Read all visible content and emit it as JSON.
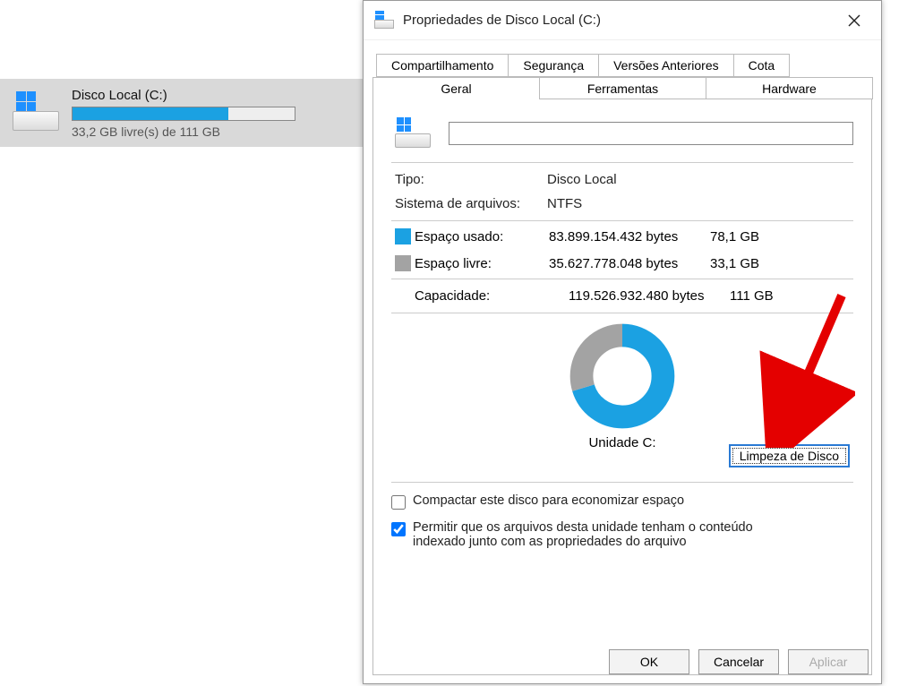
{
  "file_list": {
    "drive_title": "Disco Local (C:)",
    "drive_subtitle": "33,2 GB livre(s) de 111 GB",
    "fill_percent": 70
  },
  "dialog": {
    "title": "Propriedades de Disco Local (C:)",
    "tabs_row1": [
      "Compartilhamento",
      "Segurança",
      "Versões Anteriores",
      "Cota"
    ],
    "tabs_row2": [
      "Geral",
      "Ferramentas",
      "Hardware"
    ],
    "active_tab": "Geral",
    "name_value": "",
    "type_label": "Tipo:",
    "type_value": "Disco Local",
    "fs_label": "Sistema de arquivos:",
    "fs_value": "NTFS",
    "used_label": "Espaço usado:",
    "used_bytes": "83.899.154.432 bytes",
    "used_gb": "78,1 GB",
    "free_label": "Espaço livre:",
    "free_bytes": "35.627.778.048 bytes",
    "free_gb": "33,1 GB",
    "capacity_label": "Capacidade:",
    "capacity_bytes": "119.526.932.480 bytes",
    "capacity_gb": "111 GB",
    "chart_label": "Unidade C:",
    "cleanup_button": "Limpeza de Disco",
    "check_compress": "Compactar este disco para economizar espaço",
    "check_index_line1": "Permitir que os arquivos desta unidade tenham o conteúdo",
    "check_index_line2": "indexado junto com as propriedades do arquivo",
    "btn_ok": "OK",
    "btn_cancel": "Cancelar",
    "btn_apply": "Aplicar"
  },
  "chart_data": {
    "type": "pie",
    "title": "Unidade C:",
    "series": [
      {
        "name": "Espaço usado",
        "value": 78.1,
        "color": "#1ba1e2"
      },
      {
        "name": "Espaço livre",
        "value": 33.1,
        "color": "#a3a3a3"
      }
    ],
    "unit": "GB"
  }
}
